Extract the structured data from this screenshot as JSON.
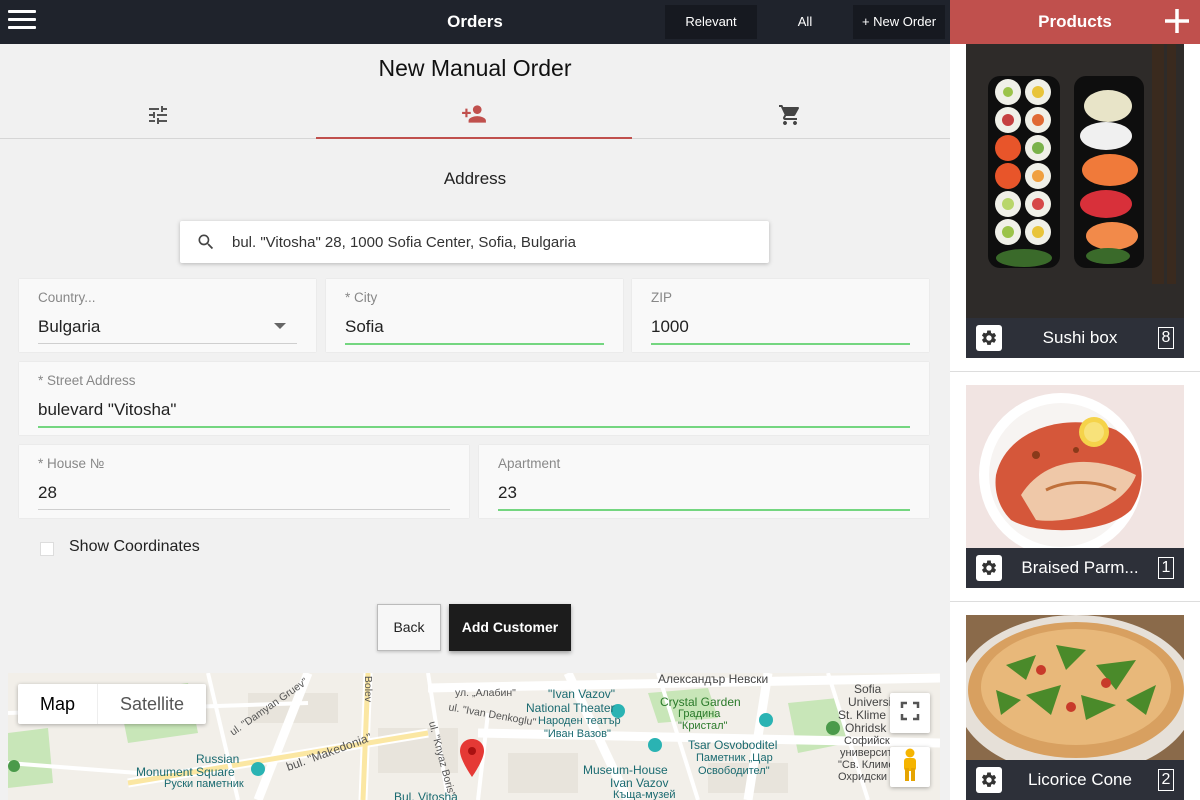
{
  "topbar": {
    "title": "Orders",
    "filters": [
      {
        "label": "Relevant"
      },
      {
        "label": "All"
      },
      {
        "label": "+ New Order"
      }
    ]
  },
  "page": {
    "title": "New Manual Order",
    "steps": [
      {
        "icon": "sliders-icon",
        "active": false
      },
      {
        "icon": "add-person-icon",
        "active": true
      },
      {
        "icon": "cart-icon",
        "active": false
      }
    ],
    "section_title": "Address"
  },
  "search": {
    "value": "bul. \"Vitosha\" 28, 1000 Sofia Center, Sofia, Bulgaria"
  },
  "form": {
    "country": {
      "label": "Country...",
      "value": "Bulgaria"
    },
    "city": {
      "label": "* City",
      "value": "Sofia"
    },
    "zip": {
      "label": "ZIP",
      "value": "1000"
    },
    "street": {
      "label": "* Street Address",
      "value": "bulevard \"Vitosha\""
    },
    "house": {
      "label": "* House №",
      "value": "28"
    },
    "apartment": {
      "label": "Apartment",
      "value": "23"
    },
    "show_coordinates": {
      "label": "Show Coordinates",
      "checked": false
    }
  },
  "actions": {
    "back": "Back",
    "add_customer": "Add Customer"
  },
  "map": {
    "type_map": "Map",
    "type_satellite": "Satellite",
    "labels": {
      "nevski": "Александър Невски",
      "crystal_en": "Crystal Garden",
      "crystal_bg1": "Градина",
      "crystal_bg2": "\"Кристал\"",
      "vazov_en1": "\"Ivan Vazov\"",
      "vazov_en2": "National Theater",
      "vazov_bg1": "Народен театър",
      "vazov_bg2": "\"Иван Вазов\"",
      "alabin": "ул. „Алабин\"",
      "tsar_en": "Tsar Osvoboditel",
      "tsar_bg1": "Паметник „Цар",
      "tsar_bg2": "Освободител\"",
      "museum_en1": "Museum-House",
      "museum_en2": "Ivan Vazov",
      "museum_bg": "Къща-музей",
      "russian_en1": "Russian",
      "russian_en2": "Monument Square",
      "russian_bg": "Руски паметник",
      "makedonia": "bul. \"Makedonia\"",
      "damyan": "ul. \"Damyan Gruev\"",
      "bolev": "Bolev",
      "knyaz": "ul. \"Knyaz Boris\"",
      "denkoglu": "ul. \"Ivan Denkoglu\"",
      "bul_vitosha": "Bul. Vitosha",
      "univ1": "Sofia",
      "univ2": "Universit",
      "univ3": "St. Klime",
      "univ4": "Ohridsk",
      "univ5": "Софийск",
      "univ6": "университ",
      "univ7": "\"Св. Климе",
      "univ8": "Охридски"
    }
  },
  "products": {
    "title": "Products",
    "items": [
      {
        "name": "Sushi box",
        "qty": "8"
      },
      {
        "name": "Braised Parm...",
        "qty": "1"
      },
      {
        "name": "Licorice Cone",
        "qty": "2"
      }
    ]
  },
  "colors": {
    "topbar": "#1f232c",
    "accent": "#c0504d",
    "valid_underline": "#74d680",
    "product_bar": "#2d3039"
  }
}
